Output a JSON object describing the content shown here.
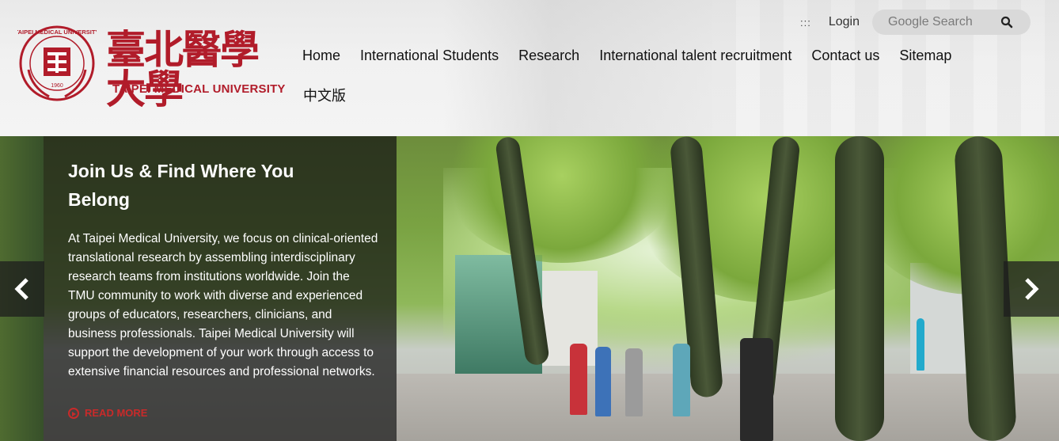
{
  "header": {
    "logo": {
      "name_cn": "臺北醫學大學",
      "name_en": "TAIPEI MEDICAL UNIVERSITY",
      "seal_text": "TAIPEI MEDICAL UNIVERSITY",
      "seal_year": "1960"
    },
    "topbar": {
      "accesskey": ":::",
      "login_label": "Login",
      "search_placeholder": "Google Search"
    },
    "nav": {
      "items": [
        {
          "label": "Home"
        },
        {
          "label": "International Students"
        },
        {
          "label": "Research"
        },
        {
          "label": "International talent recruitment"
        },
        {
          "label": "Contact us"
        },
        {
          "label": "Sitemap"
        }
      ],
      "chinese_version": "中文版"
    },
    "brand_color": "#b11c2a"
  },
  "hero": {
    "title": "Join Us & Find Where You Belong",
    "body": "At Taipei Medical University, we focus on clinical-oriented translational research by assembling interdisciplinary research teams from institutions worldwide. Join the TMU community to work with diverse and experienced groups of educators, researchers, clinicians, and business professionals. Taipei Medical University will support the development of your work through access to extensive financial resources and professional networks.",
    "read_more_label": "READ MORE",
    "read_more_color": "#c92a2a",
    "prev_icon": "chevron-left-icon",
    "next_icon": "chevron-right-icon"
  }
}
